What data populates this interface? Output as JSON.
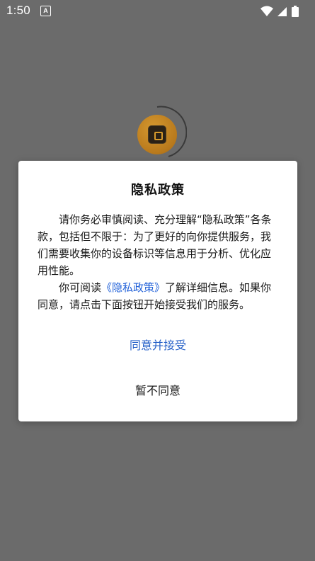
{
  "status_bar": {
    "time": "1:50",
    "notification_icon": "font-a-icon",
    "wifi_icon": "wifi-icon",
    "signal_icon": "signal-icon",
    "battery_icon": "battery-icon"
  },
  "logo": {
    "icon": "app-logo-icon",
    "ring": "loading-spinner-icon",
    "accent_color": "#c0841f"
  },
  "dialog": {
    "title": "隐私政策",
    "paragraph1": "请你务必审慎阅读、充分理解“隐私政策”各条款，包括但不限于：为了更好的向你提供服务，我们需要收集你的设备标识等信息用于分析、优化应用性能。",
    "paragraph2_before": "你可阅读",
    "paragraph2_link": "《隐私政策》",
    "paragraph2_after": "了解详细信息。如果你同意，请点击下面按钮开始接受我们的服务。",
    "agree_label": "同意并接受",
    "disagree_label": "暂不同意",
    "link_color": "#2060d8"
  }
}
